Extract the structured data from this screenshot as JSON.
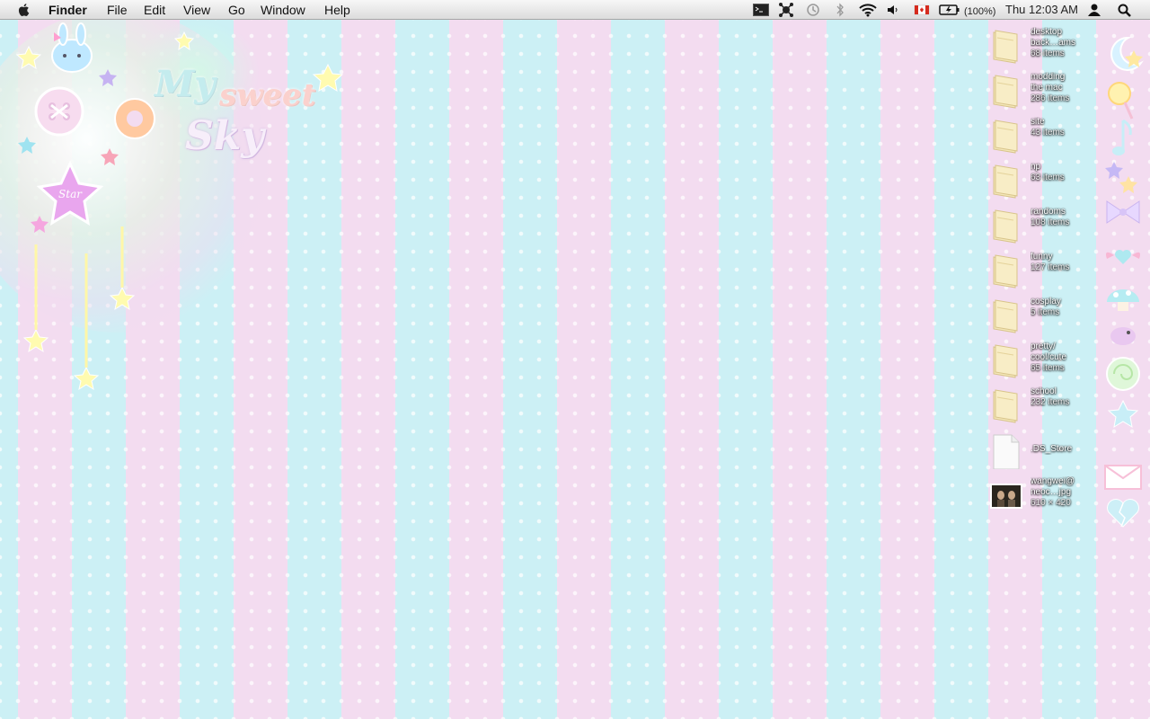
{
  "menubar": {
    "app_name": "Finder",
    "menus": [
      "File",
      "Edit",
      "View",
      "Go",
      "Window",
      "Help"
    ],
    "battery_percent": "(100%)",
    "clock": "Thu 12:03 AM",
    "status_icons": [
      "terminal-icon",
      "gear-network-icon",
      "time-machine-icon",
      "bluetooth-icon",
      "wifi-icon",
      "volume-icon",
      "canada-flag-icon",
      "battery-icon",
      "user-icon",
      "spotlight-search-icon"
    ]
  },
  "wallpaper": {
    "title_word1": "My",
    "title_word2": "sweet",
    "title_word3": "Sky",
    "badge_text": "Star",
    "colors": {
      "pink": "#f3dcf0",
      "blue": "#ccf0f5"
    }
  },
  "desktop_items": [
    {
      "lines": [
        "desktop",
        "back…ams"
      ],
      "count": "68 items",
      "kind": "folder"
    },
    {
      "lines": [
        "modding",
        "the mac"
      ],
      "count": "286 items",
      "kind": "folder"
    },
    {
      "lines": [
        "site"
      ],
      "count": "43 items",
      "kind": "folder"
    },
    {
      "lines": [
        "np"
      ],
      "count": "63 items",
      "kind": "folder"
    },
    {
      "lines": [
        "randoms"
      ],
      "count": "108 items",
      "kind": "folder"
    },
    {
      "lines": [
        "funny"
      ],
      "count": "127 items",
      "kind": "folder"
    },
    {
      "lines": [
        "cosplay"
      ],
      "count": "5 items",
      "kind": "folder"
    },
    {
      "lines": [
        "pretty/",
        "cool/cute"
      ],
      "count": "65 items",
      "kind": "folder"
    },
    {
      "lines": [
        "school"
      ],
      "count": "232 items",
      "kind": "folder"
    },
    {
      "lines": [
        ".DS_Store"
      ],
      "count": "",
      "kind": "document"
    },
    {
      "lines": [
        "wangwei@",
        "neoc…jpg"
      ],
      "count": "610 × 420",
      "kind": "image"
    }
  ],
  "side_decorations": [
    "moon-icon",
    "lollipop-icon",
    "music-note-icon",
    "stars-icon",
    "bow-icon",
    "winged-heart-icon",
    "mushroom-icon",
    "bird-icon",
    "swirl-candy-icon",
    "star-icon",
    "envelope-icon",
    "broken-heart-icon"
  ]
}
